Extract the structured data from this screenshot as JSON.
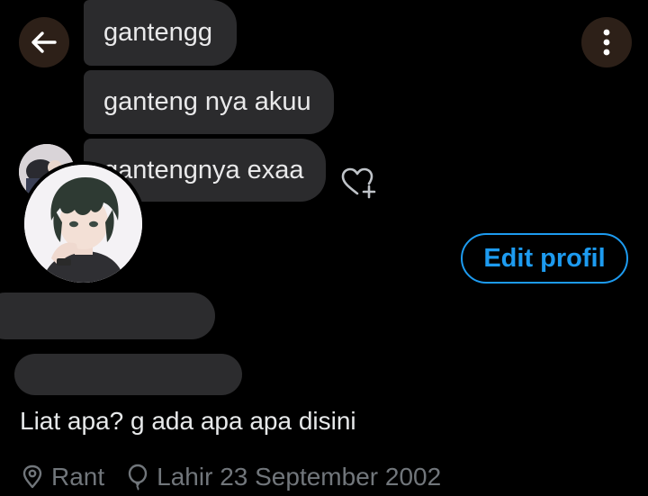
{
  "header": {
    "back_icon": "arrow-left-icon",
    "more_icon": "more-vertical-icon"
  },
  "chat": {
    "messages": [
      {
        "text": "gantengg"
      },
      {
        "text": "ganteng nya akuu"
      },
      {
        "text": "gantengnya exaa"
      }
    ],
    "react_icon": "heart-plus-icon"
  },
  "profile": {
    "edit_button_label": "Edit profil",
    "bio": "Liat apa? g ada apa apa disini",
    "location": "Rant",
    "location_icon": "location-pin-icon",
    "birthday": "Lahir 23 September 2002",
    "birthday_icon": "balloon-icon"
  },
  "colors": {
    "background": "#000000",
    "bubble": "#2b2b2d",
    "accent": "#1d9bf0",
    "muted": "#71767b",
    "icon_button_bg": "#2d2018"
  }
}
